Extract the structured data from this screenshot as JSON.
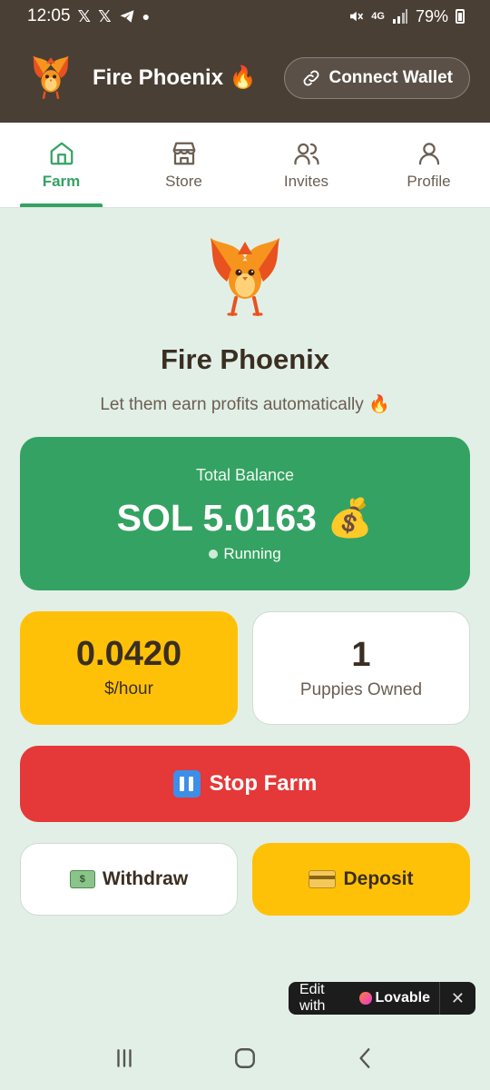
{
  "status_bar": {
    "time": "12:05",
    "notification_icons": [
      "x-icon",
      "x-icon",
      "telegram-icon",
      "dot-icon"
    ],
    "network": "4G",
    "battery": "79%"
  },
  "header": {
    "app_title": "Fire Phoenix 🔥",
    "connect_wallet_label": "Connect Wallet"
  },
  "tabs": [
    {
      "label": "Farm",
      "icon": "home-icon",
      "active": true
    },
    {
      "label": "Store",
      "icon": "store-icon",
      "active": false
    },
    {
      "label": "Invites",
      "icon": "users-icon",
      "active": false
    },
    {
      "label": "Profile",
      "icon": "user-icon",
      "active": false
    }
  ],
  "hero": {
    "title": "Fire Phoenix",
    "subtitle": "Let them earn profits automatically 🔥"
  },
  "balance": {
    "label": "Total Balance",
    "value": "SOL 5.0163 💰",
    "status": "Running"
  },
  "stats": {
    "rate_value": "0.0420",
    "rate_label": "$/hour",
    "owned_value": "1",
    "owned_label": "Puppies Owned"
  },
  "actions": {
    "stop_label": "Stop Farm",
    "withdraw_label": "Withdraw",
    "deposit_label": "Deposit"
  },
  "lovable_badge": {
    "prefix": "Edit with",
    "brand": "Lovable",
    "close": "✕"
  },
  "colors": {
    "header_bg": "#4a3f34",
    "accent_green": "#34a262",
    "accent_yellow": "#ffc107",
    "danger_red": "#e53838",
    "page_bg": "#e2efe6"
  }
}
